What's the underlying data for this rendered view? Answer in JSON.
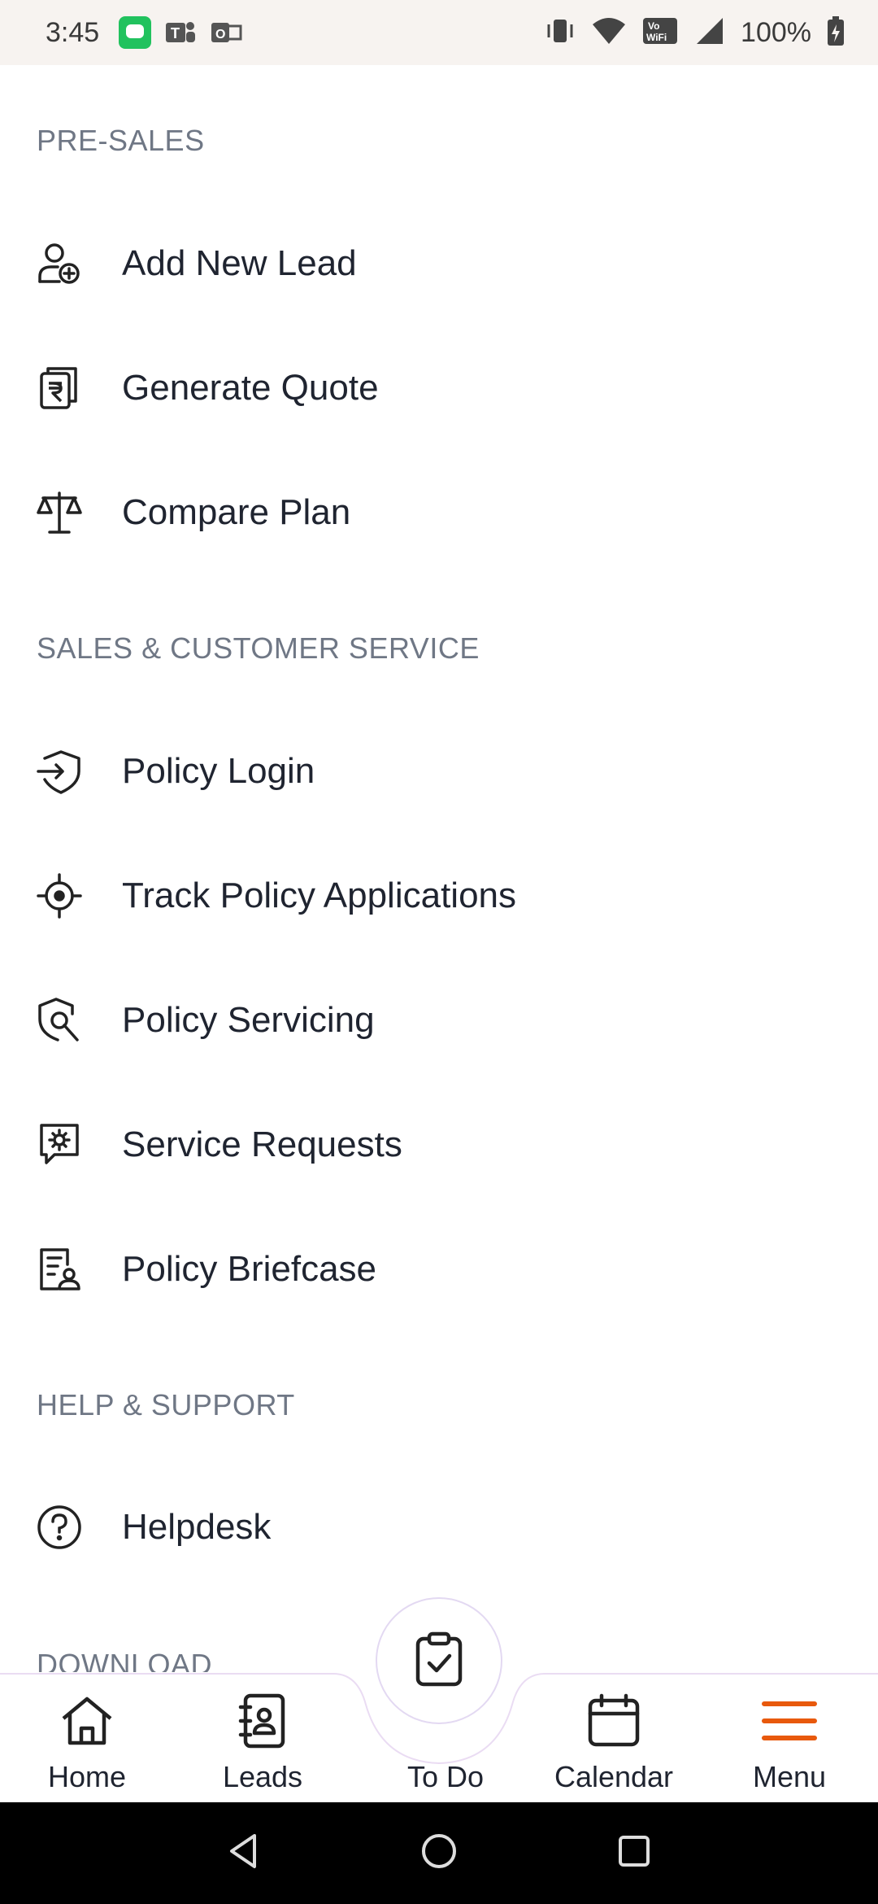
{
  "status_bar": {
    "time": "3:45",
    "battery": "100%"
  },
  "sections": {
    "pre_sales": {
      "title": "PRE-SALES",
      "items": [
        {
          "label": "Add New Lead",
          "icon": "user-add-icon"
        },
        {
          "label": "Generate Quote",
          "icon": "rupee-document-icon"
        },
        {
          "label": "Compare Plan",
          "icon": "scale-icon"
        }
      ]
    },
    "sales_service": {
      "title": "SALES & CUSTOMER SERVICE",
      "items": [
        {
          "label": "Policy Login",
          "icon": "shield-login-icon"
        },
        {
          "label": "Track Policy Applications",
          "icon": "crosshair-icon"
        },
        {
          "label": "Policy Servicing",
          "icon": "shield-wrench-icon"
        },
        {
          "label": "Service Requests",
          "icon": "gear-chat-icon"
        },
        {
          "label": "Policy Briefcase",
          "icon": "document-user-icon"
        }
      ]
    },
    "help_support": {
      "title": "HELP & SUPPORT",
      "items": [
        {
          "label": "Helpdesk",
          "icon": "question-circle-icon"
        }
      ]
    },
    "download": {
      "title": "DOWNLOAD"
    }
  },
  "bottom_nav": {
    "home": "Home",
    "leads": "Leads",
    "todo": "To Do",
    "calendar": "Calendar",
    "menu": "Menu",
    "active": "menu",
    "accent_color": "#e8590c"
  }
}
